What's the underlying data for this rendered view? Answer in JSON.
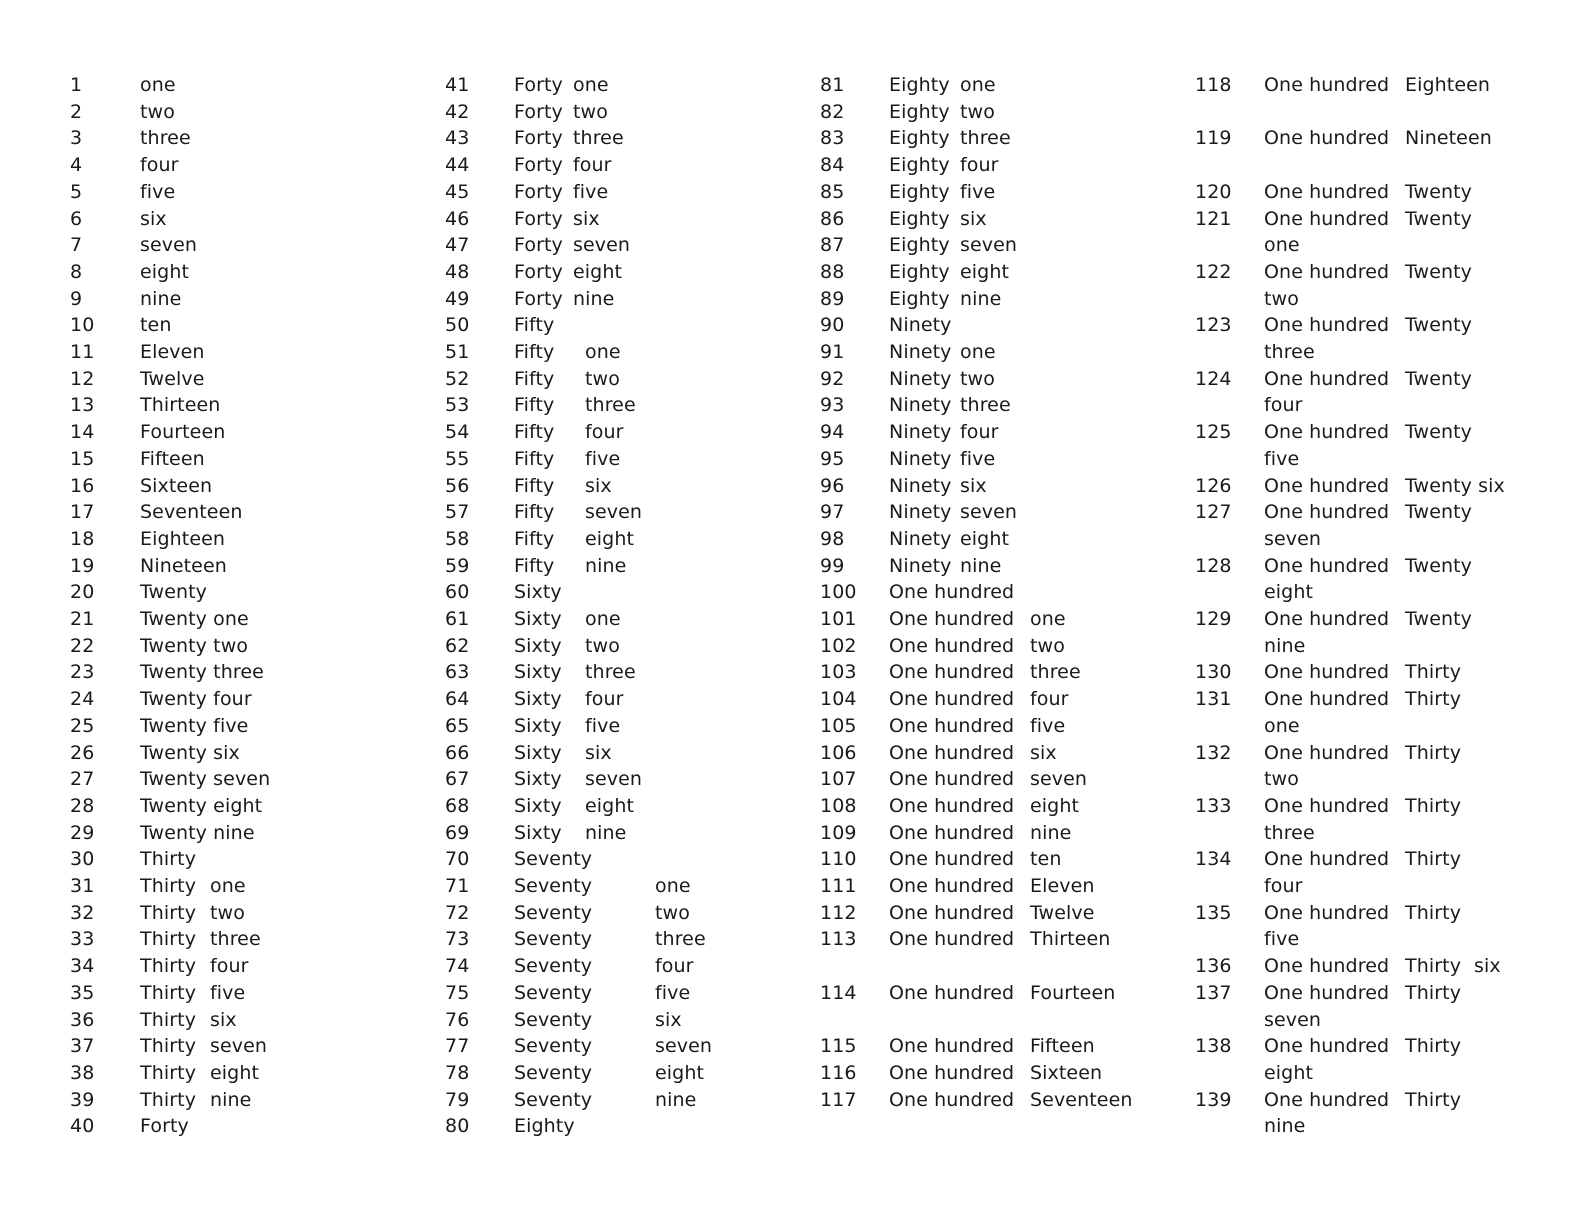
{
  "document": {
    "columns": [
      {
        "rows": [
          {
            "n": "1",
            "words": [
              "one"
            ]
          },
          {
            "n": "2",
            "words": [
              "two"
            ]
          },
          {
            "n": "3",
            "words": [
              "three"
            ]
          },
          {
            "n": "4",
            "words": [
              "four"
            ]
          },
          {
            "n": "5",
            "words": [
              "five"
            ]
          },
          {
            "n": "6",
            "words": [
              "six"
            ]
          },
          {
            "n": "7",
            "words": [
              "seven"
            ]
          },
          {
            "n": "8",
            "words": [
              "eight"
            ]
          },
          {
            "n": "9",
            "words": [
              "nine"
            ]
          },
          {
            "n": "10",
            "words": [
              "ten"
            ]
          },
          {
            "n": "11",
            "words": [
              "Eleven"
            ]
          },
          {
            "n": "12",
            "words": [
              "Twelve"
            ]
          },
          {
            "n": "13",
            "words": [
              "Thirteen"
            ]
          },
          {
            "n": "14",
            "words": [
              "Fourteen"
            ]
          },
          {
            "n": "15",
            "words": [
              "Fifteen"
            ]
          },
          {
            "n": "16",
            "words": [
              "Sixteen"
            ]
          },
          {
            "n": "17",
            "words": [
              "Seventeen"
            ]
          },
          {
            "n": "18",
            "words": [
              "Eighteen"
            ]
          },
          {
            "n": "19",
            "words": [
              "Nineteen"
            ]
          },
          {
            "n": "20",
            "words": [
              "Twenty"
            ]
          },
          {
            "n": "21",
            "words": [
              "Twenty one"
            ]
          },
          {
            "n": "22",
            "words": [
              "Twenty two"
            ]
          },
          {
            "n": "23",
            "words": [
              "Twenty three"
            ]
          },
          {
            "n": "24",
            "words": [
              "Twenty four"
            ]
          },
          {
            "n": "25",
            "words": [
              "Twenty five"
            ]
          },
          {
            "n": "26",
            "words": [
              "Twenty six"
            ]
          },
          {
            "n": "27",
            "words": [
              "Twenty seven"
            ]
          },
          {
            "n": "28",
            "words": [
              "Twenty eight"
            ]
          },
          {
            "n": "29",
            "words": [
              "Twenty nine"
            ]
          },
          {
            "n": "30",
            "words": [
              "Thirty"
            ]
          },
          {
            "n": "31",
            "words": [
              "Thirty",
              "one"
            ]
          },
          {
            "n": "32",
            "words": [
              "Thirty",
              "two"
            ]
          },
          {
            "n": "33",
            "words": [
              "Thirty",
              "three"
            ]
          },
          {
            "n": "34",
            "words": [
              "Thirty",
              "four"
            ]
          },
          {
            "n": "35",
            "words": [
              "Thirty",
              "five"
            ]
          },
          {
            "n": "36",
            "words": [
              "Thirty",
              "six"
            ]
          },
          {
            "n": "37",
            "words": [
              "Thirty",
              "seven"
            ]
          },
          {
            "n": "38",
            "words": [
              "Thirty",
              "eight"
            ]
          },
          {
            "n": "39",
            "words": [
              "Thirty",
              "nine"
            ]
          },
          {
            "n": "40",
            "words": [
              "Forty"
            ]
          }
        ]
      },
      {
        "rows": [
          {
            "n": "41",
            "words": [
              "Forty",
              "one"
            ]
          },
          {
            "n": "42",
            "words": [
              "Forty",
              "two"
            ]
          },
          {
            "n": "43",
            "words": [
              "Forty",
              "three"
            ]
          },
          {
            "n": "44",
            "words": [
              "Forty",
              "four"
            ]
          },
          {
            "n": "45",
            "words": [
              "Forty",
              "five"
            ]
          },
          {
            "n": "46",
            "words": [
              "Forty",
              "six"
            ]
          },
          {
            "n": "47",
            "words": [
              "Forty",
              "seven"
            ]
          },
          {
            "n": "48",
            "words": [
              "Forty",
              "eight"
            ]
          },
          {
            "n": "49",
            "words": [
              "Forty",
              "nine"
            ]
          },
          {
            "n": "50",
            "words": [
              "Fifty"
            ]
          },
          {
            "n": "51",
            "words": [
              "Fifty",
              "one"
            ]
          },
          {
            "n": "52",
            "words": [
              "Fifty",
              "two"
            ]
          },
          {
            "n": "53",
            "words": [
              "Fifty",
              "three"
            ]
          },
          {
            "n": "54",
            "words": [
              "Fifty",
              "four"
            ]
          },
          {
            "n": "55",
            "words": [
              "Fifty",
              "five"
            ]
          },
          {
            "n": "56",
            "words": [
              "Fifty",
              "six"
            ]
          },
          {
            "n": "57",
            "words": [
              "Fifty",
              "seven"
            ]
          },
          {
            "n": "58",
            "words": [
              "Fifty",
              "eight"
            ]
          },
          {
            "n": "59",
            "words": [
              "Fifty",
              "nine"
            ]
          },
          {
            "n": "60",
            "words": [
              "Sixty"
            ]
          },
          {
            "n": "61",
            "words": [
              "Sixty",
              "one"
            ]
          },
          {
            "n": "62",
            "words": [
              "Sixty",
              "two"
            ]
          },
          {
            "n": "63",
            "words": [
              "Sixty",
              "three"
            ]
          },
          {
            "n": "64",
            "words": [
              "Sixty",
              "four"
            ]
          },
          {
            "n": "65",
            "words": [
              "Sixty",
              "five"
            ]
          },
          {
            "n": "66",
            "words": [
              "Sixty",
              "six"
            ]
          },
          {
            "n": "67",
            "words": [
              "Sixty",
              "seven"
            ]
          },
          {
            "n": "68",
            "words": [
              "Sixty",
              "eight"
            ]
          },
          {
            "n": "69",
            "words": [
              "Sixty",
              "nine"
            ]
          },
          {
            "n": "70",
            "words": [
              "Seventy"
            ]
          },
          {
            "n": "71",
            "words": [
              "Seventy",
              "one"
            ]
          },
          {
            "n": "72",
            "words": [
              "Seventy",
              "two"
            ]
          },
          {
            "n": "73",
            "words": [
              "Seventy",
              "three"
            ]
          },
          {
            "n": "74",
            "words": [
              "Seventy",
              "four"
            ]
          },
          {
            "n": "75",
            "words": [
              "Seventy",
              "five"
            ]
          },
          {
            "n": "76",
            "words": [
              "Seventy",
              "six"
            ]
          },
          {
            "n": "77",
            "words": [
              "Seventy",
              "seven"
            ]
          },
          {
            "n": "78",
            "words": [
              "Seventy",
              "eight"
            ]
          },
          {
            "n": "79",
            "words": [
              "Seventy",
              "nine"
            ]
          },
          {
            "n": "80",
            "words": [
              "Eighty"
            ]
          }
        ]
      },
      {
        "rows": [
          {
            "n": "81",
            "words": [
              "Eighty",
              "one"
            ]
          },
          {
            "n": "82",
            "words": [
              "Eighty",
              "two"
            ]
          },
          {
            "n": "83",
            "words": [
              "Eighty",
              "three"
            ]
          },
          {
            "n": "84",
            "words": [
              "Eighty",
              "four"
            ]
          },
          {
            "n": "85",
            "words": [
              "Eighty",
              "five"
            ]
          },
          {
            "n": "86",
            "words": [
              "Eighty",
              "six"
            ]
          },
          {
            "n": "87",
            "words": [
              "Eighty",
              "seven"
            ]
          },
          {
            "n": "88",
            "words": [
              "Eighty",
              "eight"
            ]
          },
          {
            "n": "89",
            "words": [
              "Eighty",
              "nine"
            ]
          },
          {
            "n": "90",
            "words": [
              "Ninety"
            ]
          },
          {
            "n": "91",
            "words": [
              "Ninety",
              "one"
            ]
          },
          {
            "n": "92",
            "words": [
              "Ninety",
              "two"
            ]
          },
          {
            "n": "93",
            "words": [
              "Ninety",
              "three"
            ]
          },
          {
            "n": "94",
            "words": [
              "Ninety",
              "four"
            ]
          },
          {
            "n": "95",
            "words": [
              "Ninety",
              "five"
            ]
          },
          {
            "n": "96",
            "words": [
              "Ninety",
              "six"
            ]
          },
          {
            "n": "97",
            "words": [
              "Ninety",
              "seven"
            ]
          },
          {
            "n": "98",
            "words": [
              "Ninety",
              "eight"
            ]
          },
          {
            "n": "99",
            "words": [
              "Ninety",
              "nine"
            ]
          },
          {
            "n": "100",
            "words": [
              "One hundred"
            ]
          },
          {
            "n": "101",
            "words": [
              "One hundred",
              "one"
            ]
          },
          {
            "n": "102",
            "words": [
              "One hundred",
              "two"
            ]
          },
          {
            "n": "103",
            "words": [
              "One hundred",
              "three"
            ]
          },
          {
            "n": "104",
            "words": [
              "One hundred",
              "four"
            ]
          },
          {
            "n": "105",
            "words": [
              "One hundred",
              "five"
            ]
          },
          {
            "n": "106",
            "words": [
              "One hundred",
              "six"
            ]
          },
          {
            "n": "107",
            "words": [
              "One hundred",
              "seven"
            ]
          },
          {
            "n": "108",
            "words": [
              "One hundred",
              "eight"
            ]
          },
          {
            "n": "109",
            "words": [
              "One hundred",
              "nine"
            ]
          },
          {
            "n": "110",
            "words": [
              "One hundred",
              "ten"
            ]
          },
          {
            "n": "111",
            "words": [
              "One hundred",
              "Eleven"
            ]
          },
          {
            "n": "112",
            "words": [
              "One hundred",
              "Twelve"
            ]
          },
          {
            "n": "113",
            "words": [
              "One hundred",
              "Thirteen"
            ]
          },
          {
            "n": "114",
            "words": [
              "One hundred",
              "Fourteen"
            ]
          },
          {
            "n": "115",
            "words": [
              "One hundred",
              "Fifteen"
            ]
          },
          {
            "n": "116",
            "words": [
              "One hundred",
              "Sixteen"
            ]
          },
          {
            "n": "117",
            "words": [
              "One hundred",
              "Seventeen"
            ]
          }
        ]
      },
      {
        "rows": [
          {
            "n": "118",
            "words": [
              "One hundred",
              "Eighteen"
            ]
          },
          {
            "n": "119",
            "words": [
              "One hundred",
              "Nineteen"
            ]
          },
          {
            "n": "120",
            "words": [
              "One hundred",
              "Twenty"
            ]
          },
          {
            "n": "121",
            "words": [
              "One hundred",
              "Twenty"
            ],
            "wrap": "one"
          },
          {
            "n": "122",
            "words": [
              "One hundred",
              "Twenty"
            ],
            "wrap": "two"
          },
          {
            "n": "123",
            "words": [
              "One hundred",
              "Twenty"
            ],
            "wrap": "three"
          },
          {
            "n": "124",
            "words": [
              "One hundred",
              "Twenty"
            ],
            "wrap": "four"
          },
          {
            "n": "125",
            "words": [
              "One hundred",
              "Twenty"
            ],
            "wrap": "five"
          },
          {
            "n": "126",
            "words": [
              "One hundred",
              "Twenty six"
            ]
          },
          {
            "n": "127",
            "words": [
              "One hundred",
              "Twenty"
            ],
            "wrap": "seven"
          },
          {
            "n": "128",
            "words": [
              "One hundred",
              "Twenty"
            ],
            "wrap": "eight"
          },
          {
            "n": "129",
            "words": [
              "One hundred",
              "Twenty"
            ],
            "wrap": "nine"
          },
          {
            "n": "130",
            "words": [
              "One hundred",
              "Thirty"
            ]
          },
          {
            "n": "131",
            "words": [
              "One hundred",
              "Thirty"
            ],
            "wrap": "one"
          },
          {
            "n": "132",
            "words": [
              "One hundred",
              "Thirty"
            ],
            "wrap": "two"
          },
          {
            "n": "133",
            "words": [
              "One hundred",
              "Thirty"
            ],
            "wrap": "three"
          },
          {
            "n": "134",
            "words": [
              "One hundred",
              "Thirty"
            ],
            "wrap": "four"
          },
          {
            "n": "135",
            "words": [
              "One hundred",
              "Thirty"
            ],
            "wrap": "five"
          },
          {
            "n": "136",
            "words": [
              "One hundred",
              "Thirty",
              "six"
            ]
          },
          {
            "n": "137",
            "words": [
              "One hundred",
              "Thirty"
            ],
            "wrap": "seven"
          },
          {
            "n": "138",
            "words": [
              "One hundred",
              "Thirty"
            ],
            "wrap": "eight"
          },
          {
            "n": "139",
            "words": [
              "One hundred",
              "Thirty"
            ],
            "wrap": "nine"
          }
        ]
      }
    ]
  }
}
